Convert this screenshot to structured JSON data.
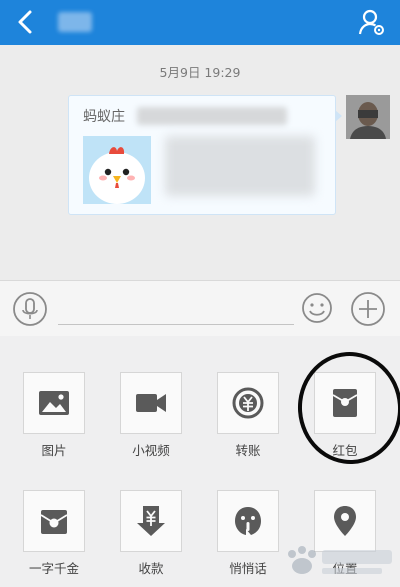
{
  "header": {
    "back_icon": "chevron-left-icon",
    "profile_icon": "person-settings-icon"
  },
  "chat": {
    "timestamp": "5月9日 19:29",
    "card_title_visible": "蚂蚁庄"
  },
  "input": {
    "voice_icon": "microphone-icon",
    "emoji_icon": "smiley-icon",
    "plus_icon": "plus-icon"
  },
  "panel": {
    "items": [
      {
        "label": "图片",
        "icon": "image-icon"
      },
      {
        "label": "小视频",
        "icon": "video-camera-icon"
      },
      {
        "label": "转账",
        "icon": "transfer-icon"
      },
      {
        "label": "红包",
        "icon": "red-envelope-icon"
      },
      {
        "label": "一字千金",
        "icon": "yuan-envelope-icon"
      },
      {
        "label": "收款",
        "icon": "receive-money-icon"
      },
      {
        "label": "悄悄话",
        "icon": "whisper-icon"
      },
      {
        "label": "位置",
        "icon": "location-pin-icon"
      }
    ]
  },
  "colors": {
    "header_bg": "#1e84db",
    "icon_gray": "#5a5a5a",
    "annotation": "#0a0a0a"
  }
}
